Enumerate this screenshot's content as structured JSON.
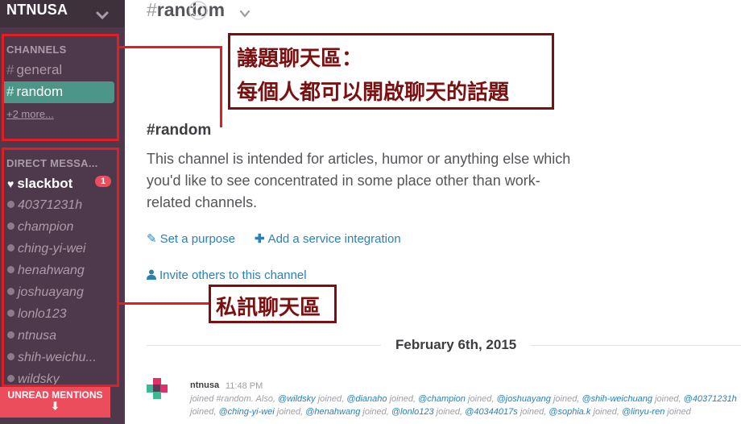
{
  "sidebar": {
    "team_name": "NTNUSA",
    "channels_title": "CHANNELS",
    "channels": [
      {
        "name": "general",
        "active": false
      },
      {
        "name": "random",
        "active": true
      }
    ],
    "more_link": "+2 more...",
    "dm_title": "DIRECT MESSA...",
    "slackbot": {
      "name": "slackbot",
      "badge": "1"
    },
    "dms": [
      "40371231h",
      "champion",
      "ching-yi-wei",
      "henahwang",
      "joshuayang",
      "lonlo123",
      "ntnusa",
      "shih-weichu...",
      "wildsky"
    ],
    "unread_button": "UNREAD MENTIONS",
    "unread_arrow": "🡇"
  },
  "annotations": {
    "channels_callout_line1": "議題聊天區：",
    "channels_callout_line2": "每個人都可以開啟聊天的話題",
    "dm_callout": "私訊聊天區"
  },
  "main": {
    "channel_title": "random",
    "intro_title": "random",
    "intro_description": "This channel is intended for articles, humor or anything else which you'd like to see concentrated in some place other than work-related channels.",
    "actions": {
      "set_purpose": "Set a purpose",
      "add_integration": "Add a service integration",
      "invite": "Invite others to this channel"
    },
    "date_divider": "February 6th, 2015",
    "message": {
      "author": "ntnusa",
      "time": "11:48 PM",
      "text_prefix": "joined #random. Also,",
      "joined": [
        "@wildsky",
        "@dianaho",
        "@champion",
        "@joshuayang",
        "@shih-weichuang",
        "@40371231h",
        "@ching-yi-wei",
        "@henahwang",
        "@lonlo123",
        "@40344017s",
        "@sophia.k",
        "@linyu-ren"
      ],
      "joined_word": "joined"
    }
  },
  "colors": {
    "sidebar_bg": "#4d394b",
    "active_channel": "#4c9689",
    "link": "#2a80b9",
    "badge": "#eb4d5c",
    "annotation_red": "#e01e24",
    "callout_text": "#7a1010"
  }
}
